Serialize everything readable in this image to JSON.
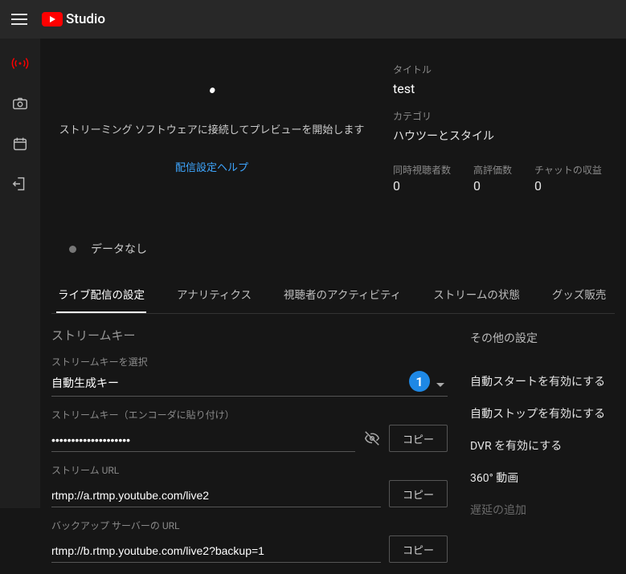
{
  "header": {
    "logo_text": "Studio"
  },
  "preview": {
    "message": "ストリーミング ソフトウェアに接続してプレビューを開始します",
    "help_link": "配信設定ヘルプ"
  },
  "info": {
    "title_label": "タイトル",
    "title_value": "test",
    "category_label": "カテゴリ",
    "category_value": "ハウツーとスタイル",
    "stats": [
      {
        "label": "同時視聴者数",
        "value": "0"
      },
      {
        "label": "高評価数",
        "value": "0"
      },
      {
        "label": "チャットの収益",
        "value": "0"
      }
    ]
  },
  "status": {
    "text": "データなし"
  },
  "tabs": [
    "ライブ配信の設定",
    "アナリティクス",
    "視聴者のアクティビティ",
    "ストリームの状態",
    "グッズ販売"
  ],
  "stream": {
    "section_title": "ストリームキー",
    "select_label": "ストリームキーを選択",
    "select_value": "自動生成キー",
    "badge": "1",
    "key_label": "ストリームキー（エンコーダに貼り付け）",
    "key_value": "••••••••••••••••••••",
    "url_label": "ストリーム URL",
    "url_value": "rtmp://a.rtmp.youtube.com/live2",
    "backup_label": "バックアップ サーバーの URL",
    "backup_value": "rtmp://b.rtmp.youtube.com/live2?backup=1",
    "copy": "コピー"
  },
  "other": {
    "heading": "その他の設定",
    "items": [
      "自動スタートを有効にする",
      "自動ストップを有効にする",
      "DVR を有効にする",
      "360° 動画",
      "遅延の追加"
    ]
  }
}
